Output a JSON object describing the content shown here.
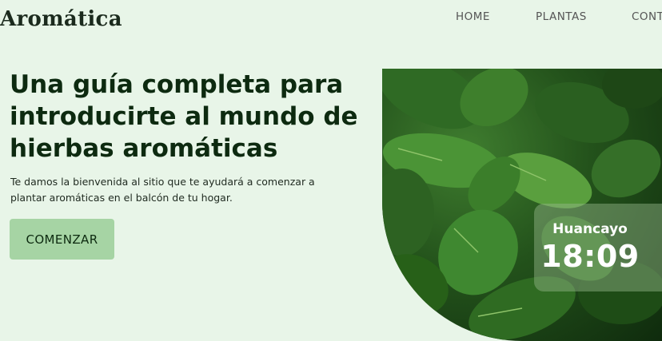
{
  "header": {
    "logo": "Aromática",
    "nav": [
      "HOME",
      "PLANTAS",
      "CONTACTO"
    ]
  },
  "hero": {
    "title": "Una guía completa para introducirte al mundo de hierbas aromáticas",
    "subtitle": "Te damos la bienvenida al sitio que te ayudará a comenzar a plantar aromáticas en el balcón de tu hogar.",
    "cta_label": "COMENZAR"
  },
  "clock": {
    "city": "Huancayo",
    "time": "18:09"
  },
  "colors": {
    "background": "#e8f5e8",
    "heading": "#0d2a10",
    "cta": "#a6d4a4"
  }
}
